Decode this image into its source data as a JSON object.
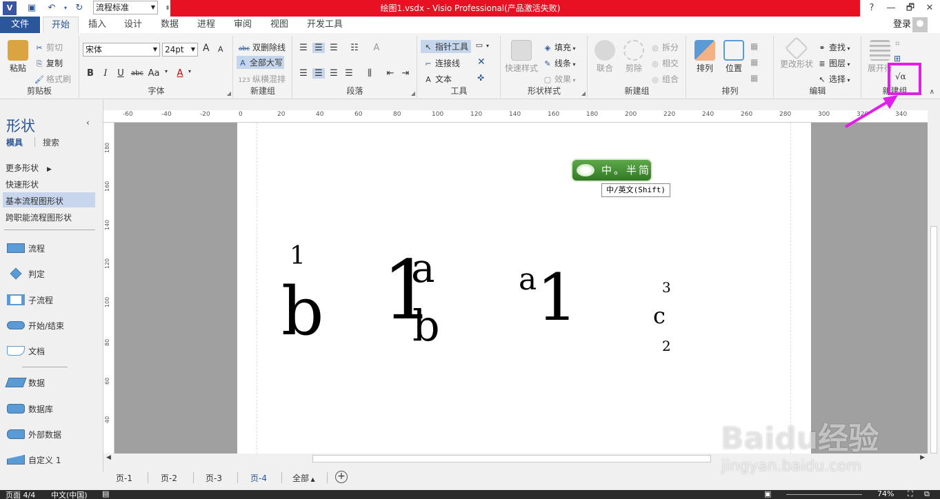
{
  "titlebar": {
    "title": "绘图1.vsdx - Visio Professional(产品激活失败)",
    "style_select": "流程标准",
    "help": "?",
    "restore": "🗗",
    "close": "✕",
    "visio_logo": "V"
  },
  "tabs": [
    "文件",
    "开始",
    "插入",
    "设计",
    "数据",
    "进程",
    "审阅",
    "视图",
    "开发工具"
  ],
  "login": "登录",
  "ribbon": {
    "clipboard": {
      "label": "剪贴板",
      "paste": "粘贴",
      "cut": "剪切",
      "copy": "复制",
      "format_painter": "格式刷"
    },
    "font": {
      "label": "字体",
      "family": "宋体",
      "size": "24pt",
      "bold": "B",
      "italic": "I",
      "underline": "U",
      "strike": "abc",
      "case": "Aa",
      "color": "A",
      "grow": "A",
      "shrink": "A"
    },
    "newgroup1": {
      "label": "新建组",
      "double_strike": "双删除线",
      "all_caps": "全部大写",
      "vertical_mix": "纵横混排"
    },
    "paragraph": {
      "label": "段落"
    },
    "tools": {
      "label": "工具",
      "pointer": "指针工具",
      "connector": "连接线",
      "text": "文本"
    },
    "shape_styles": {
      "label": "形状样式",
      "quick_styles": "快速样式",
      "fill": "填充",
      "line": "线条",
      "effects": "效果"
    },
    "newgroup2": {
      "label": "新建组",
      "union": "联合",
      "fragment": "剪除",
      "split": "拆分",
      "intersect": "相交",
      "combine": "组合"
    },
    "arrange": {
      "label": "排列",
      "arrange": "排列",
      "position": "位置"
    },
    "edit": {
      "label": "编辑",
      "change_shape": "更改形状",
      "find": "查找",
      "layers": "图层",
      "select": "选择"
    },
    "newgroup3": {
      "label": "新建组",
      "expand": "展开行",
      "equation": "√α"
    }
  },
  "shapes_pane": {
    "title": "形状",
    "tab_stencils": "模具",
    "tab_search": "搜索",
    "more_shapes": "更多形状",
    "quick_shapes": "快速形状",
    "basic_flowchart": "基本流程图形状",
    "cross_functional": "跨职能流程图形状",
    "items": [
      "流程",
      "判定",
      "子流程",
      "开始/结束",
      "文档",
      "数据",
      "数据库",
      "外部数据",
      "自定义 1"
    ]
  },
  "ruler_h": [
    "-60",
    "-40",
    "-20",
    "0",
    "20",
    "40",
    "60",
    "80",
    "100",
    "120",
    "140",
    "160",
    "180",
    "200",
    "220",
    "240",
    "260",
    "280",
    "300",
    "320",
    "340"
  ],
  "ruler_v": [
    "180",
    "160",
    "140",
    "120",
    "100",
    "80",
    "60",
    "40"
  ],
  "canvas": {
    "g1_sup": "1",
    "g1_base": "b",
    "g2_base": "1",
    "g2_sup": "a",
    "g2_sub": "b",
    "g3_pre": "a",
    "g3_base": "1",
    "g4_top": "3",
    "g4_base": "c",
    "g4_bottom": "2"
  },
  "ime": {
    "label": "中。半简",
    "tooltip": "中/英文(Shift)"
  },
  "page_tabs": [
    "页-1",
    "页-2",
    "页-3",
    "页-4"
  ],
  "page_tabs_all": "全部",
  "status": {
    "page": "页面 4/4",
    "lang": "中文(中国)",
    "zoom": "74%"
  },
  "watermark": {
    "logo": "Baidu经验",
    "url": "jingyan.baidu.com"
  }
}
